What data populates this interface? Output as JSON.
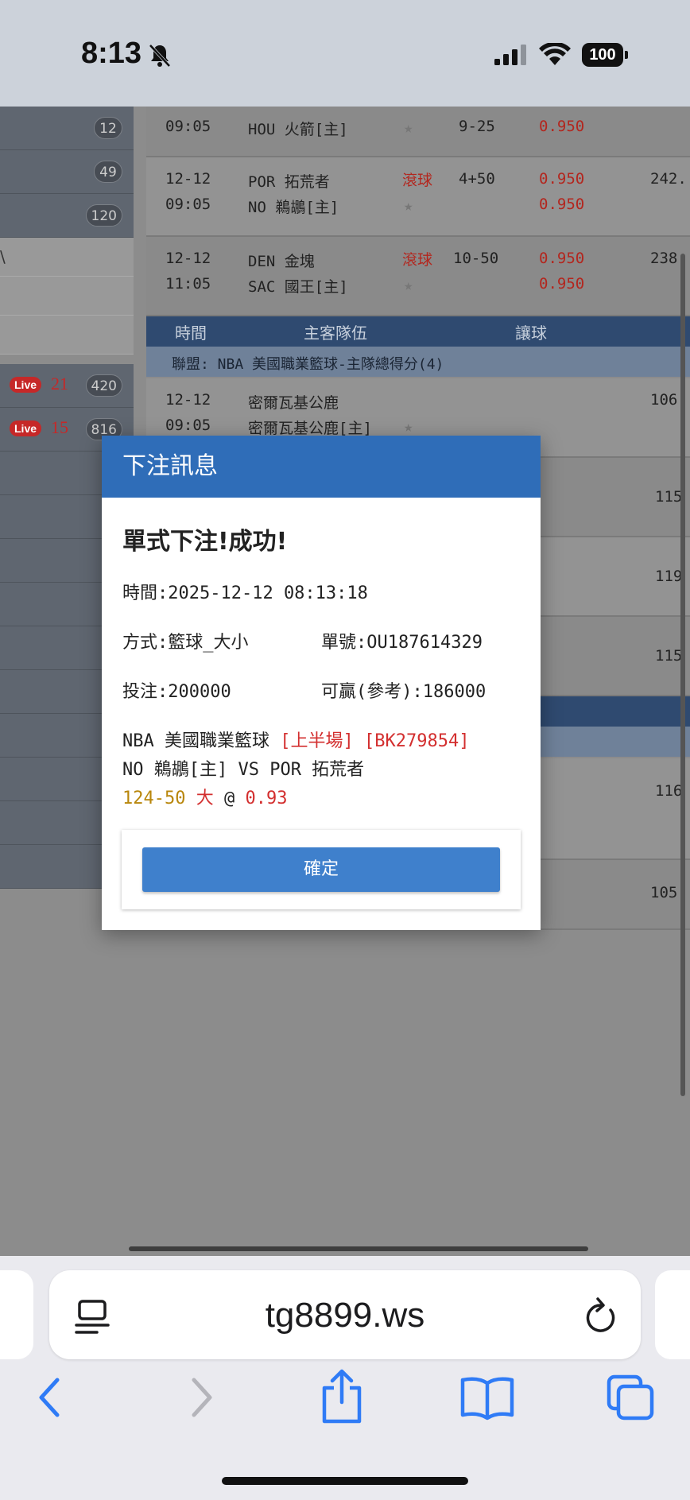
{
  "status_bar": {
    "time": "8:13",
    "battery": "100"
  },
  "sidebar": {
    "rows": [
      {
        "count": "12"
      },
      {
        "count": "49"
      },
      {
        "count": "120"
      },
      {
        "count": ""
      },
      {
        "count": ""
      },
      {
        "count": ""
      },
      {
        "live": "Live",
        "live_num": "21",
        "count": "420"
      },
      {
        "live": "Live",
        "live_num": "15",
        "count": "816"
      }
    ]
  },
  "matches": [
    {
      "date": "",
      "time": "09:05",
      "home": "",
      "away": "HOU 火箭[主]",
      "status": "",
      "handicap": "9-25",
      "odds1": "",
      "odds2": "0.950",
      "extra": ""
    },
    {
      "date": "12-12",
      "time": "09:05",
      "home": "POR 拓荒者",
      "away": "NO 鵜鶘[主]",
      "status": "滾球",
      "handicap": "4+50",
      "odds1": "0.950",
      "odds2": "0.950",
      "extra": "242."
    },
    {
      "date": "12-12",
      "time": "11:05",
      "home": "DEN 金塊",
      "away": "SAC 國王[主]",
      "status": "滾球",
      "handicap": "10-50",
      "odds1": "0.950",
      "odds2": "0.950",
      "extra": "238."
    }
  ],
  "table_header": {
    "col1": "時間",
    "col2": "主客隊伍",
    "col3": "讓球"
  },
  "league_row": "聯盟: NBA 美國職業籃球-主隊總得分(4)",
  "team_match": {
    "date": "12-12",
    "time": "09:05",
    "home": "密爾瓦基公鹿",
    "away": "密爾瓦基公鹿[主]",
    "extra": "106."
  },
  "right_values": [
    "115",
    "119",
    "115",
    "116",
    "105."
  ],
  "modal": {
    "header": "下注訊息",
    "title": "單式下注!成功!",
    "time_line": "時間:2025-12-12 08:13:18",
    "method": "方式:籃球_大小",
    "order_no": "單號:OU187614329",
    "stake": "投注:200000",
    "win": "可贏(參考):186000",
    "league": "NBA 美國職業籃球",
    "half": "[上半場]",
    "bet_code": "[BK279854]",
    "teams": "NO 鵜鶘[主] VS POR 拓荒者",
    "line_score": "124-50",
    "pick": "大",
    "at": "@",
    "odds": "0.93",
    "confirm": "確定"
  },
  "browser": {
    "url": "tg8899.ws"
  }
}
